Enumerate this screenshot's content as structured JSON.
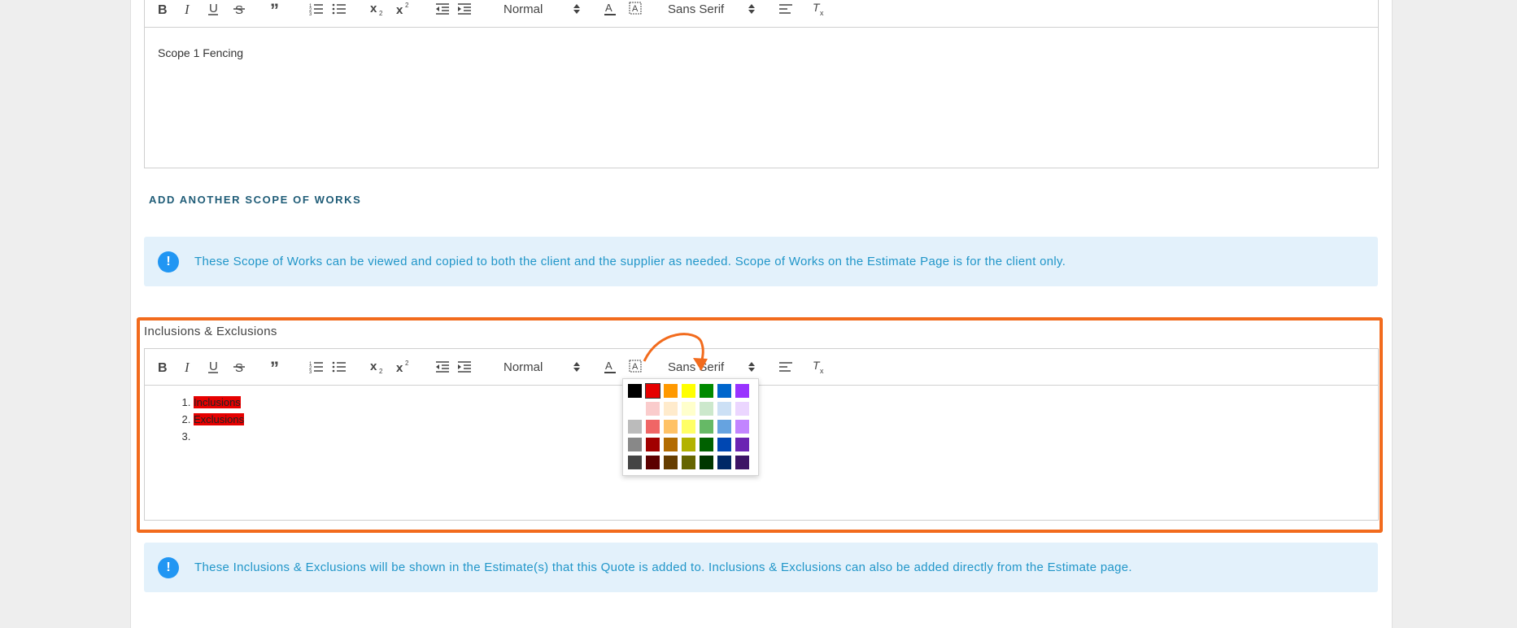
{
  "editor1": {
    "text": "Scope 1 Fencing",
    "header_select": "Normal",
    "font_select": "Sans Serif"
  },
  "add_scope_label": "ADD ANOTHER SCOPE OF WORKS",
  "info1": {
    "icon": "!",
    "text": "These Scope of Works can be viewed and copied to both the client and the supplier as needed. Scope of Works on the Estimate Page is for the client only."
  },
  "section2": {
    "label": "Inclusions & Exclusions",
    "header_select": "Normal",
    "font_select": "Sans Serif",
    "items": [
      "Inclusions",
      "Exclusions",
      ""
    ]
  },
  "info2": {
    "icon": "!",
    "text": "These Inclusions & Exclusions will be shown in the Estimate(s) that this Quote is added to. Inclusions & Exclusions can also be added directly from the Estimate page."
  },
  "colors": {
    "accent_orange": "#f26b1d",
    "info_bg": "#e3f1fb",
    "info_text": "#2196c9",
    "highlight_red": "#e60000"
  },
  "palette": [
    [
      "#000000",
      "#e60000",
      "#ff9900",
      "#ffff00",
      "#008a00",
      "#0066cc",
      "#9933ff"
    ],
    [
      "#ffffff",
      "#facccc",
      "#ffebcc",
      "#ffffcc",
      "#cce8cc",
      "#cce0f5",
      "#ebd6ff"
    ],
    [
      "#bbbbbb",
      "#f06666",
      "#ffc266",
      "#ffff66",
      "#66b966",
      "#66a3e0",
      "#c285ff"
    ],
    [
      "#888888",
      "#a10000",
      "#b26b00",
      "#b2b200",
      "#006100",
      "#0047b2",
      "#6b24b2"
    ],
    [
      "#444444",
      "#5c0000",
      "#663d00",
      "#666600",
      "#003700",
      "#002966",
      "#3d1466"
    ]
  ]
}
